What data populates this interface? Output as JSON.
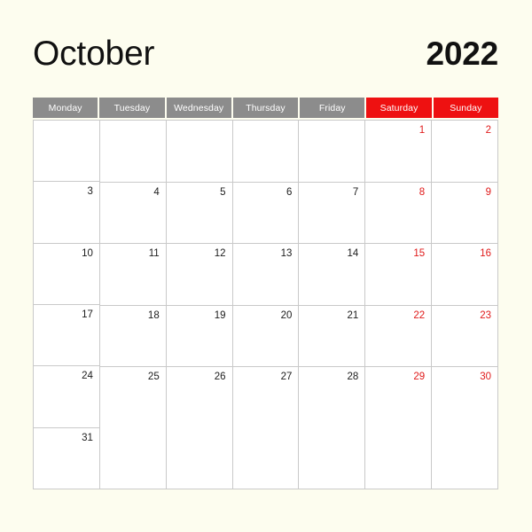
{
  "calendar": {
    "month": "October",
    "year": "2022",
    "colors": {
      "page_background": "#fdfdef",
      "header_weekday": "#8c8c8c",
      "header_weekend": "#ee1111",
      "weekend_text": "#e01b1b",
      "weekday_text": "#1c1c1c",
      "grid_line": "#c9c9c9",
      "cell_background": "#ffffff"
    },
    "weekdays": [
      {
        "label": "Monday",
        "weekend": false
      },
      {
        "label": "Tuesday",
        "weekend": false
      },
      {
        "label": "Wednesday",
        "weekend": false
      },
      {
        "label": "Thursday",
        "weekend": false
      },
      {
        "label": "Friday",
        "weekend": false
      },
      {
        "label": "Saturday",
        "weekend": true
      },
      {
        "label": "Sunday",
        "weekend": true
      }
    ],
    "columns": [
      {
        "weekday": "Monday",
        "weekend": false,
        "days": [
          "",
          "3",
          "10",
          "17",
          "24",
          "31"
        ]
      },
      {
        "weekday": "Tuesday",
        "weekend": false,
        "days": [
          "",
          "4",
          "11",
          "18",
          "25"
        ]
      },
      {
        "weekday": "Wednesday",
        "weekend": false,
        "days": [
          "",
          "5",
          "12",
          "19",
          "26"
        ]
      },
      {
        "weekday": "Thursday",
        "weekend": false,
        "days": [
          "",
          "6",
          "13",
          "20",
          "27"
        ]
      },
      {
        "weekday": "Friday",
        "weekend": false,
        "days": [
          "",
          "7",
          "14",
          "21",
          "28"
        ]
      },
      {
        "weekday": "Saturday",
        "weekend": true,
        "days": [
          "1",
          "8",
          "15",
          "22",
          "29"
        ]
      },
      {
        "weekday": "Sunday",
        "weekend": true,
        "days": [
          "2",
          "9",
          "16",
          "23",
          "30"
        ]
      }
    ],
    "weeks": [
      [
        "",
        "",
        "",
        "",
        "",
        "1",
        "2"
      ],
      [
        "3",
        "4",
        "5",
        "6",
        "7",
        "8",
        "9"
      ],
      [
        "10",
        "11",
        "12",
        "13",
        "14",
        "15",
        "16"
      ],
      [
        "17",
        "18",
        "19",
        "20",
        "21",
        "22",
        "23"
      ],
      [
        "24",
        "25",
        "26",
        "27",
        "28",
        "29",
        "30"
      ],
      [
        "31",
        "",
        "",
        "",
        "",
        "",
        ""
      ]
    ]
  }
}
